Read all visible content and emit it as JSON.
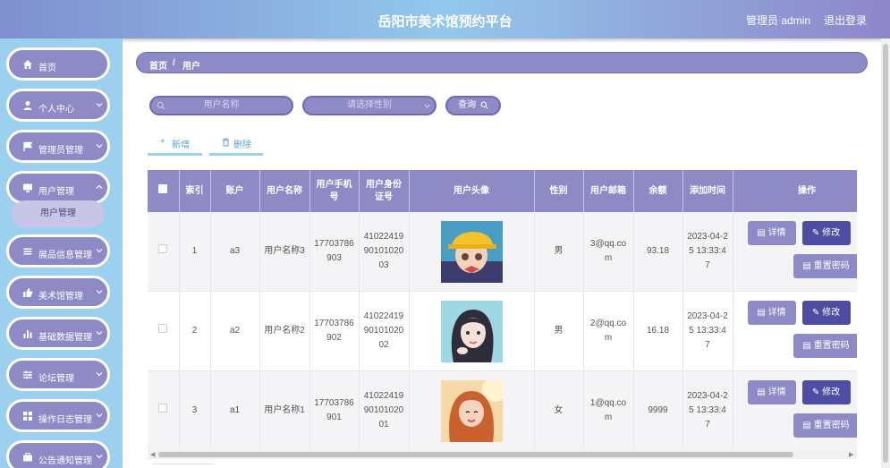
{
  "header": {
    "title": "岳阳市美术馆预约平台",
    "user": "管理员 admin",
    "logout": "退出登录"
  },
  "sidebar": {
    "items": [
      {
        "label": "首页",
        "icon": "home-icon",
        "chevron": false
      },
      {
        "label": "个人中心",
        "icon": "user-icon",
        "chevron": true
      },
      {
        "label": "管理员管理",
        "icon": "flag-icon",
        "chevron": true
      },
      {
        "label": "用户管理",
        "icon": "monitor-icon",
        "chevron": true
      },
      {
        "label": "展品信息管理",
        "icon": "list-icon",
        "chevron": true
      },
      {
        "label": "美术馆管理",
        "icon": "thumb-icon",
        "chevron": true
      },
      {
        "label": "基础数据管理",
        "icon": "bar-chart-icon",
        "chevron": true
      },
      {
        "label": "论坛管理",
        "icon": "sliders-icon",
        "chevron": true
      },
      {
        "label": "操作日志管理",
        "icon": "grid-icon",
        "chevron": true
      },
      {
        "label": "公告通知管理",
        "icon": "briefcase-icon",
        "chevron": true
      }
    ],
    "submenu": "用户管理"
  },
  "breadcrumb": {
    "home": "首页",
    "sep": "/",
    "current": "用户"
  },
  "search": {
    "name_placeholder": "用户名称",
    "gender_placeholder": "请选择性别",
    "query": "查询"
  },
  "toolbar": {
    "add": "新增",
    "delete": "删除"
  },
  "table": {
    "headers": [
      "",
      "索引",
      "账户",
      "用户名称",
      "用户手机号",
      "用户身份证号",
      "用户头像",
      "性别",
      "用户邮箱",
      "余额",
      "添加时间",
      "操作"
    ],
    "rows": [
      {
        "index": "1",
        "account": "a3",
        "name": "用户名称3",
        "phone": "17703786903",
        "idcard": "410224199010102003",
        "gender": "男",
        "email": "3@qq.com",
        "balance": "93.18",
        "time": "2023-04-25 13:33:47"
      },
      {
        "index": "2",
        "account": "a2",
        "name": "用户名称2",
        "phone": "17703786902",
        "idcard": "410224199010102002",
        "gender": "男",
        "email": "2@qq.com",
        "balance": "16.18",
        "time": "2023-04-25 13:33:47"
      },
      {
        "index": "3",
        "account": "a1",
        "name": "用户名称1",
        "phone": "17703786901",
        "idcard": "410224199010102001",
        "gender": "女",
        "email": "1@qq.com",
        "balance": "9999",
        "time": "2023-04-25 13:33:47"
      }
    ],
    "actions": {
      "detail": "详情",
      "edit": "修改",
      "reset": "重置密码"
    }
  },
  "colors": {
    "purple": "#8e8ac6",
    "dark_purple": "#4d4da3",
    "sky": "#9bd0ef",
    "link": "#5aa3c9"
  }
}
